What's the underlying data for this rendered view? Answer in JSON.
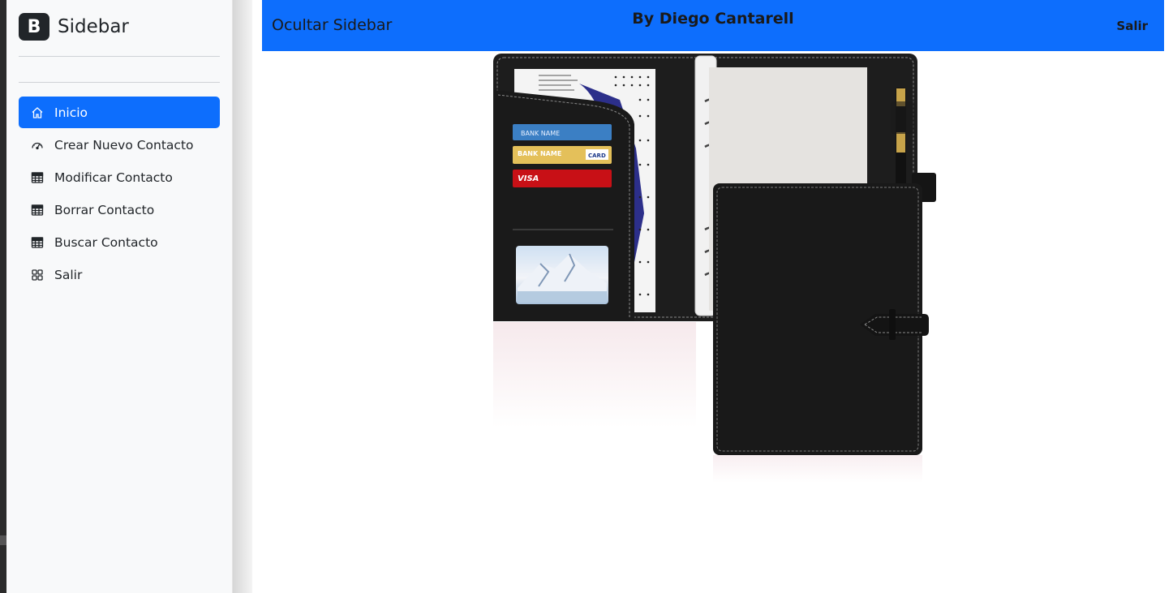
{
  "sidebar": {
    "brand_logo": "B",
    "brand_title": "Sidebar",
    "items": [
      {
        "label": "Inicio",
        "icon": "home-icon",
        "active": true
      },
      {
        "label": "Crear Nuevo Contacto",
        "icon": "speedometer-icon",
        "active": false
      },
      {
        "label": "Modificar Contacto",
        "icon": "table-icon",
        "active": false
      },
      {
        "label": "Borrar Contacto",
        "icon": "table-icon",
        "active": false
      },
      {
        "label": "Buscar Contacto",
        "icon": "table-icon",
        "active": false
      },
      {
        "label": "Salir",
        "icon": "grid-icon",
        "active": false
      }
    ]
  },
  "header": {
    "toggle_label": "Ocultar Sidebar",
    "author": "By Diego Cantarell",
    "logout_label": "Salir"
  },
  "main": {
    "card1_label": "BANK NAME",
    "card2_label": "BANK NAME",
    "card2_badge": "CARD",
    "card3_label": "VISA"
  },
  "colors": {
    "accent": "#0d6efd",
    "sidebar_bg": "#f8f9fa",
    "text": "#212529"
  }
}
